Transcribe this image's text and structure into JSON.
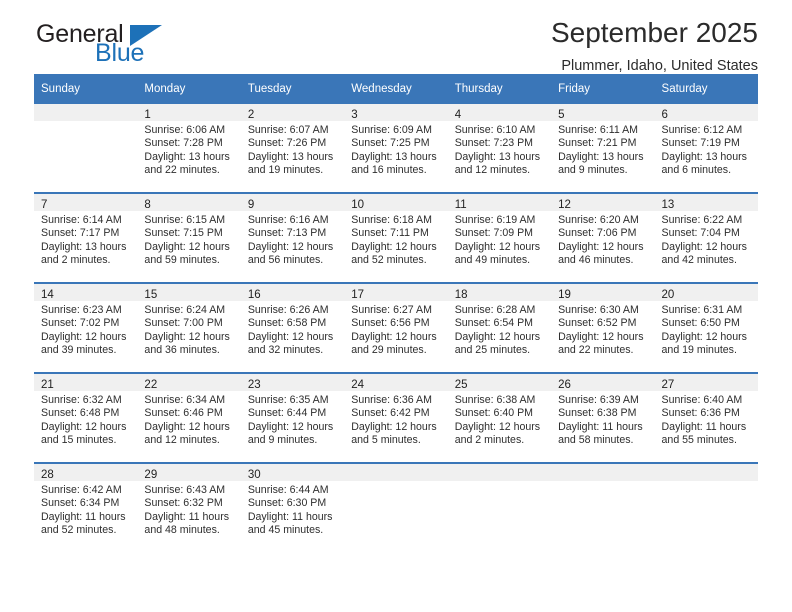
{
  "brand": {
    "name_part1": "General",
    "name_part2": "Blue",
    "triangle_color": "#1d71b8"
  },
  "header": {
    "title": "September 2025",
    "subtitle": "Plummer, Idaho, United States",
    "accent_color": "#3a76b8"
  },
  "weekdays": [
    "Sunday",
    "Monday",
    "Tuesday",
    "Wednesday",
    "Thursday",
    "Friday",
    "Saturday"
  ],
  "weeks": [
    [
      {
        "day": "",
        "sunrise": "",
        "sunset": "",
        "daylight_line1": "",
        "daylight_line2": ""
      },
      {
        "day": "1",
        "sunrise": "Sunrise: 6:06 AM",
        "sunset": "Sunset: 7:28 PM",
        "daylight_line1": "Daylight: 13 hours",
        "daylight_line2": "and 22 minutes."
      },
      {
        "day": "2",
        "sunrise": "Sunrise: 6:07 AM",
        "sunset": "Sunset: 7:26 PM",
        "daylight_line1": "Daylight: 13 hours",
        "daylight_line2": "and 19 minutes."
      },
      {
        "day": "3",
        "sunrise": "Sunrise: 6:09 AM",
        "sunset": "Sunset: 7:25 PM",
        "daylight_line1": "Daylight: 13 hours",
        "daylight_line2": "and 16 minutes."
      },
      {
        "day": "4",
        "sunrise": "Sunrise: 6:10 AM",
        "sunset": "Sunset: 7:23 PM",
        "daylight_line1": "Daylight: 13 hours",
        "daylight_line2": "and 12 minutes."
      },
      {
        "day": "5",
        "sunrise": "Sunrise: 6:11 AM",
        "sunset": "Sunset: 7:21 PM",
        "daylight_line1": "Daylight: 13 hours",
        "daylight_line2": "and 9 minutes."
      },
      {
        "day": "6",
        "sunrise": "Sunrise: 6:12 AM",
        "sunset": "Sunset: 7:19 PM",
        "daylight_line1": "Daylight: 13 hours",
        "daylight_line2": "and 6 minutes."
      }
    ],
    [
      {
        "day": "7",
        "sunrise": "Sunrise: 6:14 AM",
        "sunset": "Sunset: 7:17 PM",
        "daylight_line1": "Daylight: 13 hours",
        "daylight_line2": "and 2 minutes."
      },
      {
        "day": "8",
        "sunrise": "Sunrise: 6:15 AM",
        "sunset": "Sunset: 7:15 PM",
        "daylight_line1": "Daylight: 12 hours",
        "daylight_line2": "and 59 minutes."
      },
      {
        "day": "9",
        "sunrise": "Sunrise: 6:16 AM",
        "sunset": "Sunset: 7:13 PM",
        "daylight_line1": "Daylight: 12 hours",
        "daylight_line2": "and 56 minutes."
      },
      {
        "day": "10",
        "sunrise": "Sunrise: 6:18 AM",
        "sunset": "Sunset: 7:11 PM",
        "daylight_line1": "Daylight: 12 hours",
        "daylight_line2": "and 52 minutes."
      },
      {
        "day": "11",
        "sunrise": "Sunrise: 6:19 AM",
        "sunset": "Sunset: 7:09 PM",
        "daylight_line1": "Daylight: 12 hours",
        "daylight_line2": "and 49 minutes."
      },
      {
        "day": "12",
        "sunrise": "Sunrise: 6:20 AM",
        "sunset": "Sunset: 7:06 PM",
        "daylight_line1": "Daylight: 12 hours",
        "daylight_line2": "and 46 minutes."
      },
      {
        "day": "13",
        "sunrise": "Sunrise: 6:22 AM",
        "sunset": "Sunset: 7:04 PM",
        "daylight_line1": "Daylight: 12 hours",
        "daylight_line2": "and 42 minutes."
      }
    ],
    [
      {
        "day": "14",
        "sunrise": "Sunrise: 6:23 AM",
        "sunset": "Sunset: 7:02 PM",
        "daylight_line1": "Daylight: 12 hours",
        "daylight_line2": "and 39 minutes."
      },
      {
        "day": "15",
        "sunrise": "Sunrise: 6:24 AM",
        "sunset": "Sunset: 7:00 PM",
        "daylight_line1": "Daylight: 12 hours",
        "daylight_line2": "and 36 minutes."
      },
      {
        "day": "16",
        "sunrise": "Sunrise: 6:26 AM",
        "sunset": "Sunset: 6:58 PM",
        "daylight_line1": "Daylight: 12 hours",
        "daylight_line2": "and 32 minutes."
      },
      {
        "day": "17",
        "sunrise": "Sunrise: 6:27 AM",
        "sunset": "Sunset: 6:56 PM",
        "daylight_line1": "Daylight: 12 hours",
        "daylight_line2": "and 29 minutes."
      },
      {
        "day": "18",
        "sunrise": "Sunrise: 6:28 AM",
        "sunset": "Sunset: 6:54 PM",
        "daylight_line1": "Daylight: 12 hours",
        "daylight_line2": "and 25 minutes."
      },
      {
        "day": "19",
        "sunrise": "Sunrise: 6:30 AM",
        "sunset": "Sunset: 6:52 PM",
        "daylight_line1": "Daylight: 12 hours",
        "daylight_line2": "and 22 minutes."
      },
      {
        "day": "20",
        "sunrise": "Sunrise: 6:31 AM",
        "sunset": "Sunset: 6:50 PM",
        "daylight_line1": "Daylight: 12 hours",
        "daylight_line2": "and 19 minutes."
      }
    ],
    [
      {
        "day": "21",
        "sunrise": "Sunrise: 6:32 AM",
        "sunset": "Sunset: 6:48 PM",
        "daylight_line1": "Daylight: 12 hours",
        "daylight_line2": "and 15 minutes."
      },
      {
        "day": "22",
        "sunrise": "Sunrise: 6:34 AM",
        "sunset": "Sunset: 6:46 PM",
        "daylight_line1": "Daylight: 12 hours",
        "daylight_line2": "and 12 minutes."
      },
      {
        "day": "23",
        "sunrise": "Sunrise: 6:35 AM",
        "sunset": "Sunset: 6:44 PM",
        "daylight_line1": "Daylight: 12 hours",
        "daylight_line2": "and 9 minutes."
      },
      {
        "day": "24",
        "sunrise": "Sunrise: 6:36 AM",
        "sunset": "Sunset: 6:42 PM",
        "daylight_line1": "Daylight: 12 hours",
        "daylight_line2": "and 5 minutes."
      },
      {
        "day": "25",
        "sunrise": "Sunrise: 6:38 AM",
        "sunset": "Sunset: 6:40 PM",
        "daylight_line1": "Daylight: 12 hours",
        "daylight_line2": "and 2 minutes."
      },
      {
        "day": "26",
        "sunrise": "Sunrise: 6:39 AM",
        "sunset": "Sunset: 6:38 PM",
        "daylight_line1": "Daylight: 11 hours",
        "daylight_line2": "and 58 minutes."
      },
      {
        "day": "27",
        "sunrise": "Sunrise: 6:40 AM",
        "sunset": "Sunset: 6:36 PM",
        "daylight_line1": "Daylight: 11 hours",
        "daylight_line2": "and 55 minutes."
      }
    ],
    [
      {
        "day": "28",
        "sunrise": "Sunrise: 6:42 AM",
        "sunset": "Sunset: 6:34 PM",
        "daylight_line1": "Daylight: 11 hours",
        "daylight_line2": "and 52 minutes."
      },
      {
        "day": "29",
        "sunrise": "Sunrise: 6:43 AM",
        "sunset": "Sunset: 6:32 PM",
        "daylight_line1": "Daylight: 11 hours",
        "daylight_line2": "and 48 minutes."
      },
      {
        "day": "30",
        "sunrise": "Sunrise: 6:44 AM",
        "sunset": "Sunset: 6:30 PM",
        "daylight_line1": "Daylight: 11 hours",
        "daylight_line2": "and 45 minutes."
      },
      {
        "day": "",
        "sunrise": "",
        "sunset": "",
        "daylight_line1": "",
        "daylight_line2": ""
      },
      {
        "day": "",
        "sunrise": "",
        "sunset": "",
        "daylight_line1": "",
        "daylight_line2": ""
      },
      {
        "day": "",
        "sunrise": "",
        "sunset": "",
        "daylight_line1": "",
        "daylight_line2": ""
      },
      {
        "day": "",
        "sunrise": "",
        "sunset": "",
        "daylight_line1": "",
        "daylight_line2": ""
      }
    ]
  ]
}
